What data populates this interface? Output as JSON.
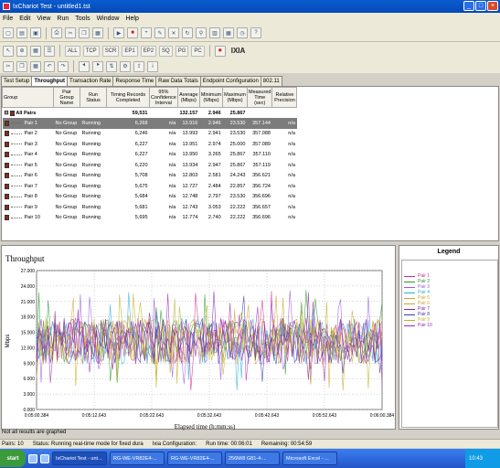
{
  "window": {
    "title": "IxChariot Test - untitled1.tst"
  },
  "menu": [
    "File",
    "Edit",
    "View",
    "Run",
    "Tools",
    "Window",
    "Help"
  ],
  "toolbar2": {
    "labels": [
      "ALL",
      "TCP",
      "SCR",
      "EP1",
      "EP2",
      "SQ",
      "PG",
      "PC"
    ],
    "brand": "IXIA"
  },
  "tabs": [
    "Test Setup",
    "Throughput",
    "Transaction Rate",
    "Response Time",
    "Raw Data Totals",
    "Endpoint Configuration",
    "802.11"
  ],
  "grid": {
    "headers": [
      "Group",
      "Pair Group Name",
      "Run Status",
      "Timing Records Completed",
      "95% Confidence Interval",
      "Average (Mbps)",
      "Minimum (Mbps)",
      "Maximum (Mbps)",
      "Measured Time (sec)",
      "Relative Precision"
    ],
    "all_pairs": {
      "label": "All Pairs",
      "records": "59,531",
      "average": "132.157",
      "minimum": "2.946",
      "maximum": "25.867"
    },
    "rows": [
      [
        "Pair 1",
        "No Group",
        "Running",
        "6,268",
        "n/a",
        "13.916",
        "2.946",
        "23.530",
        "357.144",
        "n/a"
      ],
      [
        "Pair 2",
        "No Group",
        "Running",
        "6,246",
        "n/a",
        "13.993",
        "2.941",
        "23.530",
        "357.088",
        "n/a"
      ],
      [
        "Pair 3",
        "No Group",
        "Running",
        "6,227",
        "n/a",
        "13.951",
        "2.974",
        "25.000",
        "357.089",
        "n/a"
      ],
      [
        "Pair 4",
        "No Group",
        "Running",
        "6,227",
        "n/a",
        "13.950",
        "3.265",
        "25.867",
        "357.110",
        "n/a"
      ],
      [
        "Pair 5",
        "No Group",
        "Running",
        "6,220",
        "n/a",
        "13.934",
        "2.947",
        "25.867",
        "357.119",
        "n/a"
      ],
      [
        "Pair 6",
        "No Group",
        "Running",
        "5,708",
        "n/a",
        "12.803",
        "2.581",
        "24.243",
        "356.621",
        "n/a"
      ],
      [
        "Pair 7",
        "No Group",
        "Running",
        "5,675",
        "n/a",
        "12.727",
        "2.484",
        "22.857",
        "356.724",
        "n/a"
      ],
      [
        "Pair 8",
        "No Group",
        "Running",
        "5,684",
        "n/a",
        "12.748",
        "2.797",
        "23.530",
        "356.696",
        "n/a"
      ],
      [
        "Pair 9",
        "No Group",
        "Running",
        "5,681",
        "n/a",
        "12.743",
        "3.053",
        "22.222",
        "356.657",
        "n/a"
      ],
      [
        "Pair 10",
        "No Group",
        "Running",
        "5,695",
        "n/a",
        "12.774",
        "2.740",
        "22.222",
        "356.696",
        "n/a"
      ]
    ]
  },
  "chart": {
    "title": "Throughput",
    "footnote": "Not all results are graphed"
  },
  "chart_data": {
    "type": "line",
    "ylabel": "Mbps",
    "xlabel": "Elapsed time (h:mm:ss)",
    "ylim": [
      0,
      27
    ],
    "yticks": [
      "27.000",
      "24.000",
      "21.000",
      "18.000",
      "15.000",
      "12.000",
      "9.000",
      "6.000",
      "3.000",
      "0.000"
    ],
    "xticks": [
      "0:05:00.384",
      "0:05:12.643",
      "0:05:22.643",
      "0:05:32.643",
      "0:05:42.643",
      "0:05:52.643",
      "0:06:00.384"
    ],
    "band_mean": 13.3,
    "series": [
      {
        "name": "Pair 1",
        "color": "#cc2a9a"
      },
      {
        "name": "Pair 2",
        "color": "#2a9a2a"
      },
      {
        "name": "Pair 3",
        "color": "#9a5ae0"
      },
      {
        "name": "Pair 4",
        "color": "#2ab0d8"
      },
      {
        "name": "Pair 5",
        "color": "#d2a822"
      },
      {
        "name": "Pair 6",
        "color": "#d0a030"
      },
      {
        "name": "Pair 7",
        "color": "#7a2aa8"
      },
      {
        "name": "Pair 8",
        "color": "#3a3ab0"
      },
      {
        "name": "Pair 9",
        "color": "#c0b028"
      },
      {
        "name": "Pair 10",
        "color": "#a02ab0"
      }
    ]
  },
  "legend": {
    "title": "Legend"
  },
  "status": {
    "pairs": "Pairs: 10",
    "status": "Status: Running real-time mode for fixed dura",
    "ixia_config": "Ixia Configuration:",
    "run_time": "Run time: 00:06:01",
    "remaining": "Remaining: 00:54:59"
  },
  "taskbar": {
    "start": "start",
    "tasks": [
      "IxChariot Test - unt...",
      "RG-WE-VR82E4-...",
      "RG-WE-VR82E4-...",
      "256M/8 G81-4-...",
      "Microsoft Excel - ..."
    ],
    "clock": "10:43"
  }
}
